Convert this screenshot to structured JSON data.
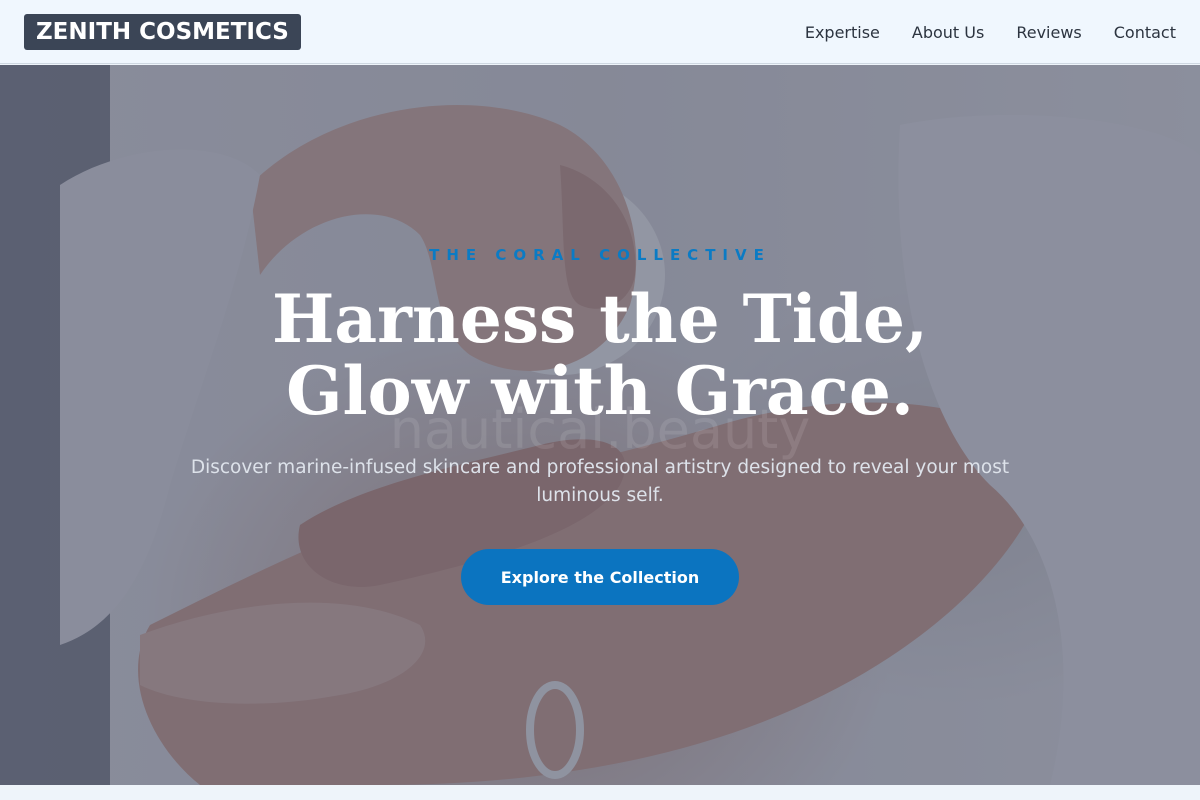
{
  "header": {
    "brand": "ZENITH COSMETICS",
    "nav": [
      {
        "label": "Expertise"
      },
      {
        "label": "About Us"
      },
      {
        "label": "Reviews"
      },
      {
        "label": "Contact"
      }
    ]
  },
  "hero": {
    "eyebrow": "THE CORAL COLLECTIVE",
    "title_line1": "Harness the Tide,",
    "title_line2": "Glow with Grace.",
    "ghost_text": "nautical.beauty",
    "subtitle": "Discover marine-infused skincare and professional artistry designed to reveal your most luminous self.",
    "cta_label": "Explore the Collection",
    "background_image": "hands applying cream from a white jar"
  },
  "colors": {
    "accent": "#0b74c0",
    "brand_bg": "#3b4556",
    "header_bg": "#f0f7fe"
  }
}
